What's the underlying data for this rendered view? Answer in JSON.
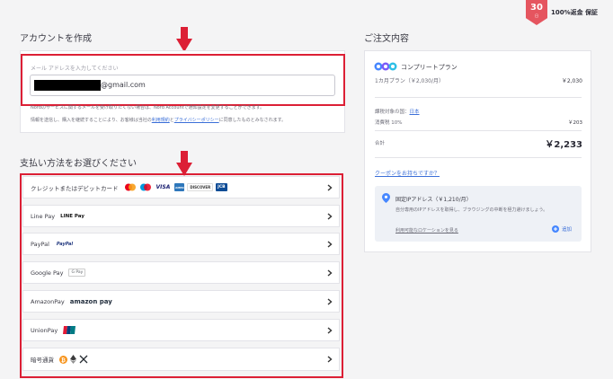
{
  "badge": {
    "days": "30",
    "days_unit": "日"
  },
  "guarantee": "100%返金 保証",
  "account": {
    "heading": "アカウントを作成",
    "email_label": "メール アドレスを入力してください",
    "email_domain": "@gmail.com",
    "note_line1": "Nordのサービスに関するメールを受け取りたくない場合は、Nord Accountで通知設定を変更することができます。",
    "note_line2_prefix": "情報を送信し、購入を継続することにより、お客様は当社の",
    "terms_link": "利用規約",
    "note_line2_and": "と",
    "privacy_link": "プライバシーポリシー",
    "note_line2_suffix": "に同意したものとみなされます。"
  },
  "payment": {
    "heading": "支払い方法をお選びください",
    "methods": [
      {
        "label": "クレジットまたはデビットカード"
      },
      {
        "label": "Line Pay",
        "logo": "LINE Pay"
      },
      {
        "label": "PayPal",
        "logo": "PayPal"
      },
      {
        "label": "Google Pay",
        "logo": "G Pay"
      },
      {
        "label": "AmazonPay",
        "logo": "amazon pay"
      },
      {
        "label": "UnionPay",
        "logo": "UnionPay"
      },
      {
        "label": "暗号通貨"
      }
    ],
    "card_logos": {
      "visa": "VISA",
      "discover": "DISCOVER",
      "jcb": "JCB",
      "amex": "AMEX"
    }
  },
  "order": {
    "heading": "ご注文内容",
    "plan_name": "コンプリートプラン",
    "plan_period": "1カ月プラン（￥2,030/月）",
    "plan_price": "￥2,030",
    "tax_country_label": "課税対象の国：",
    "tax_country": "日本",
    "tax_rate_label": "消費税 10%",
    "tax_amount": "￥203",
    "total_label": "合計",
    "total_amount": "￥2,233",
    "coupon_link": "クーポンをお持ちですか？",
    "addon_title": "固定IPアドレス（￥1,210/月）",
    "addon_desc": "自分専用のIPアドレスを取得し、ブラウジングの中断を極力避けましょう。",
    "addon_locations_link": "利用可能なロケーションを見る",
    "addon_add_label": "追加"
  },
  "colors": {
    "highlight_red": "#dc1f35",
    "link_blue": "#3b6fd8",
    "badge_red": "#e5555f"
  }
}
